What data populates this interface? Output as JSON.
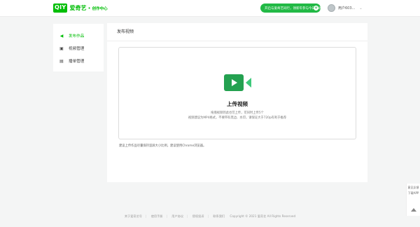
{
  "header": {
    "logo_box": "QIY",
    "logo_text": "爱奇艺",
    "logo_dot": "•",
    "logo_sub": "创作中心",
    "join_button": "开启与爱奇艺同行，领新年参与今日活动",
    "join_icon": "plus-icon",
    "username": "用户603...",
    "caret": "⌄"
  },
  "sidebar": {
    "items": [
      {
        "icon": "send-icon",
        "glyph": "◀",
        "label": "发布作品",
        "active": true
      },
      {
        "icon": "video-manage-icon",
        "glyph": "▣",
        "label": "视频管理",
        "active": false
      },
      {
        "icon": "playlist-icon",
        "glyph": "▤",
        "label": "播单管理",
        "active": false
      }
    ]
  },
  "main": {
    "title": "发布视频",
    "upload": {
      "icon": "video-camera-icon",
      "title": "上传视频",
      "desc1": "拖拽视频到此也可上传，可同时上传5个",
      "desc2": "视频建议为MP4格式，不要带有黑边、水印，请保证大于720p有利于推荐"
    },
    "notice": "建议上传作品尽量保持竖屏大小比例，建议使用Chrome浏览器。"
  },
  "float_bar": {
    "item1": "意见反馈",
    "item2": "下载APP",
    "top_icon": "back-to-top-icon"
  },
  "footer": {
    "links": [
      "关于爱奇艺号",
      "使用手册",
      "用户协议",
      "侵权投诉",
      "联系我们"
    ],
    "copyright": "Copyright © 2021 爱奇艺 All Rights Reserved"
  },
  "colors": {
    "brand_green": "#00be06",
    "button_green": "#21b945",
    "camera_green": "#24a150"
  }
}
